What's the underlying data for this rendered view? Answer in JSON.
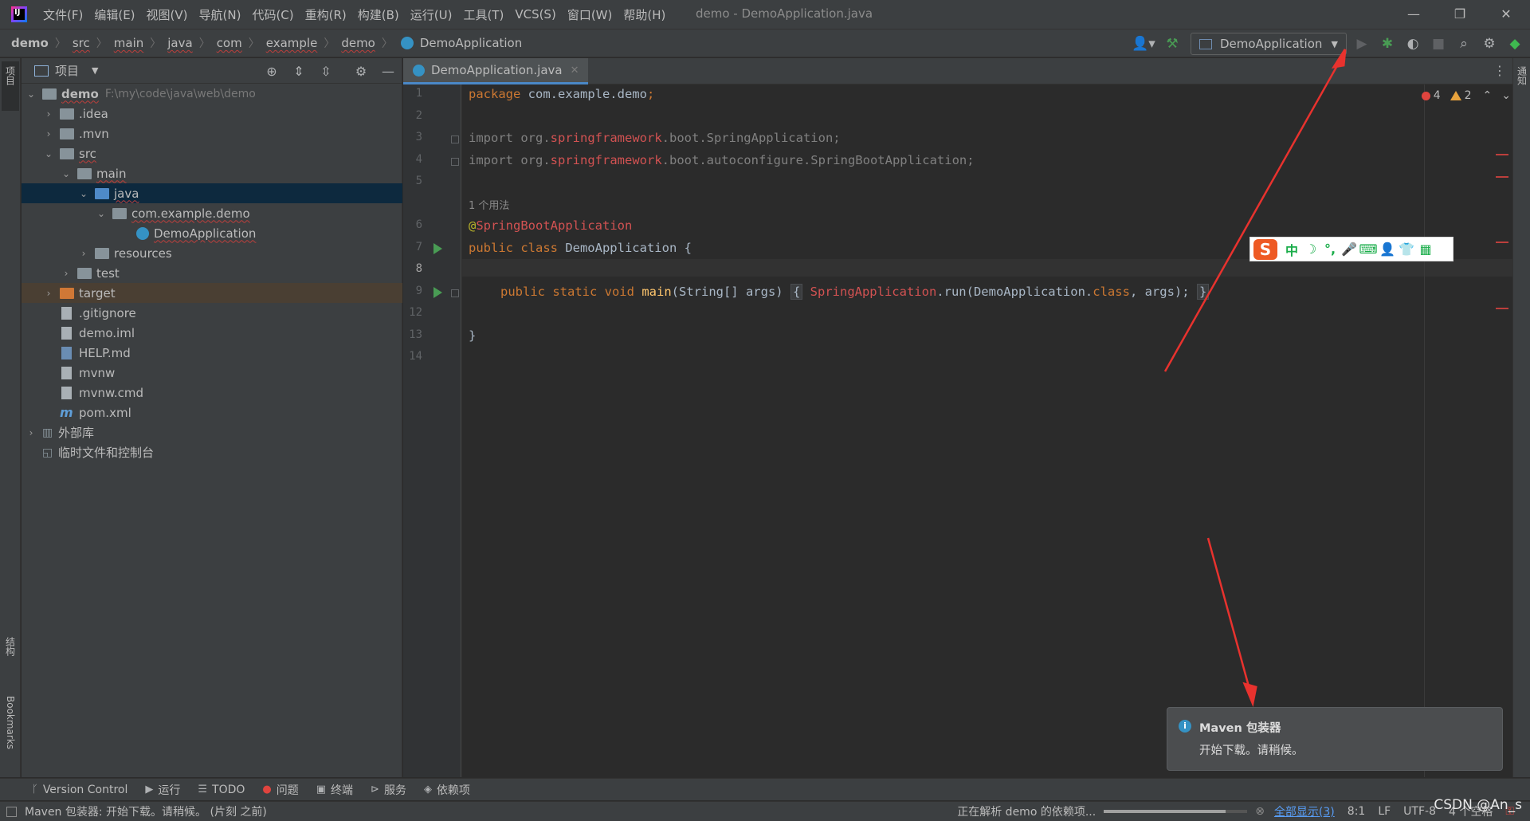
{
  "menubar": {
    "items": [
      "文件(F)",
      "编辑(E)",
      "视图(V)",
      "导航(N)",
      "代码(C)",
      "重构(R)",
      "构建(B)",
      "运行(U)",
      "工具(T)",
      "VCS(S)",
      "窗口(W)",
      "帮助(H)"
    ],
    "window_title": "demo - DemoApplication.java"
  },
  "breadcrumb": [
    "demo",
    "src",
    "main",
    "java",
    "com",
    "example",
    "demo",
    "DemoApplication"
  ],
  "run_config": "DemoApplication",
  "project_panel": {
    "title": "项目",
    "tree": [
      {
        "label": "demo",
        "path": "F:\\my\\code\\java\\web\\demo"
      },
      {
        "label": ".idea"
      },
      {
        "label": ".mvn"
      },
      {
        "label": "src"
      },
      {
        "label": "main"
      },
      {
        "label": "java"
      },
      {
        "label": "com.example.demo"
      },
      {
        "label": "DemoApplication"
      },
      {
        "label": "resources"
      },
      {
        "label": "test"
      },
      {
        "label": "target"
      },
      {
        "label": ".gitignore"
      },
      {
        "label": "demo.iml"
      },
      {
        "label": "HELP.md"
      },
      {
        "label": "mvnw"
      },
      {
        "label": "mvnw.cmd"
      },
      {
        "label": "pom.xml"
      },
      {
        "label": "外部库"
      },
      {
        "label": "临时文件和控制台"
      }
    ]
  },
  "left_stripe": {
    "project": "项目",
    "structure": "结构",
    "bookmarks": "Bookmarks"
  },
  "right_stripe": {
    "notifications": "通知"
  },
  "editor": {
    "tab": "DemoApplication.java",
    "line_numbers": [
      "1",
      "2",
      "3",
      "4",
      "5",
      "6",
      "7",
      "8",
      "9",
      "12",
      "13",
      "14"
    ],
    "usage_hint": "1 个用法",
    "code": {
      "l1_kw": "package",
      "l1_rest": " com.example.demo",
      "l1_semi": ";",
      "l3_kw": "import",
      "l3_a": " org.",
      "l3_b": "springframework",
      "l3_c": ".boot.SpringApplication;",
      "l4_kw": "import",
      "l4_a": " org.",
      "l4_b": "springframework",
      "l4_c": ".boot.autoconfigure.SpringBootApplication;",
      "l6_at": "@",
      "l6_ann": "SpringBootApplication",
      "l7_kw": "public class",
      "l7_rest": " DemoApplication {",
      "l9_kw": "public static void",
      "l9_fn": "main",
      "l9_args": "(String[] args) ",
      "l9_open": "{",
      "l9_cls": "SpringApplication",
      "l9_run": ".run(DemoApplication.",
      "l9_kw2": "class",
      "l9_end": ", args);",
      "l9_close": "}",
      "l13": "}"
    },
    "errors": "4",
    "warnings": "2"
  },
  "ime": {
    "logo": "S",
    "items": [
      "中",
      "☽",
      "°,",
      "🎤",
      "⌨",
      "👤",
      "👕",
      "▦"
    ]
  },
  "notification": {
    "title": "Maven 包装器",
    "body": "开始下载。请稍候。"
  },
  "toolwindows": [
    "Version Control",
    "运行",
    "TODO",
    "问题",
    "终端",
    "服务",
    "依赖项"
  ],
  "statusbar": {
    "left": "Maven 包装器: 开始下载。请稍候。 (片刻 之前)",
    "task": "正在解析 demo 的依赖项...",
    "progress": 0.85,
    "show_all": "全部显示(3)",
    "position": "8:1",
    "line_sep": "LF",
    "encoding": "UTF-8",
    "indent": "4 个空格"
  },
  "watermark": "CSDN @An_s",
  "colors": {
    "accent": "#4a88c7",
    "arrow": "#e8322e",
    "run_green": "#499c54"
  }
}
